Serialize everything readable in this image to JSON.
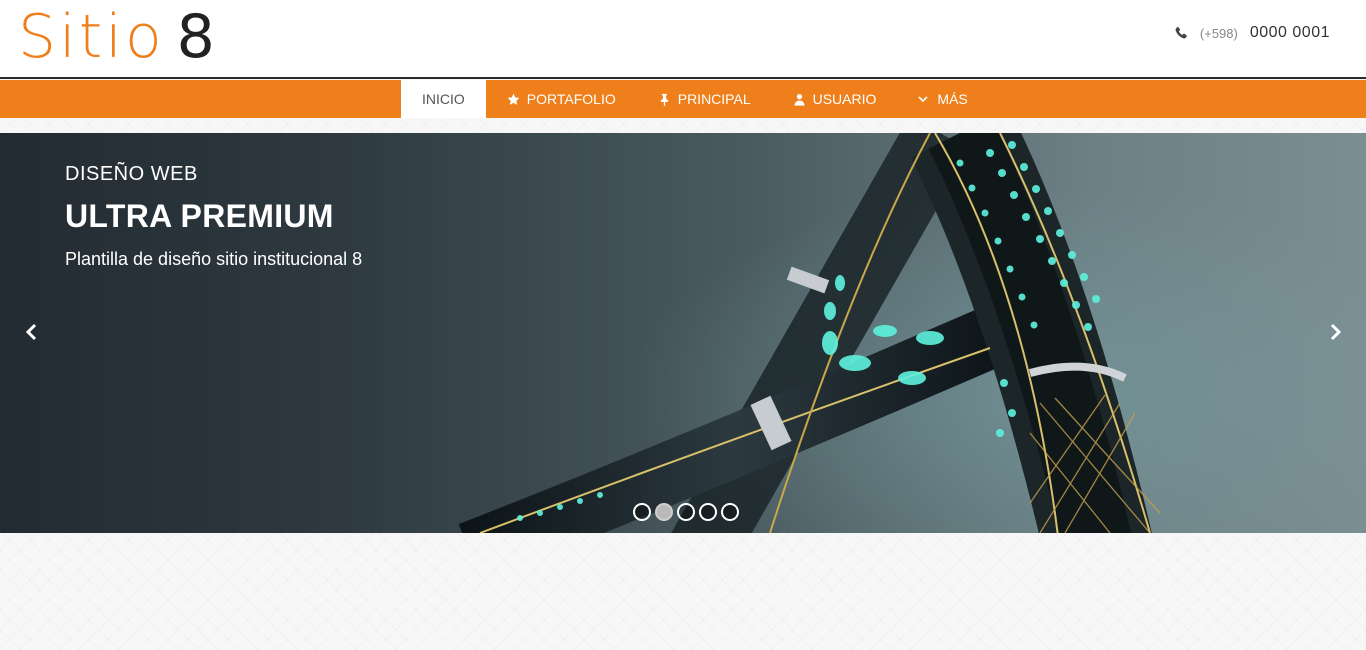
{
  "header": {
    "logo_word": "Sitio",
    "logo_number": "8",
    "phone_prefix": "(+598)",
    "phone_number": "0000 0001",
    "phone_icon": "phone-icon"
  },
  "nav": {
    "items": [
      {
        "label": "INICIO",
        "icon": null,
        "active": true
      },
      {
        "label": "PORTAFOLIO",
        "icon": "star-icon",
        "active": false
      },
      {
        "label": "PRINCIPAL",
        "icon": "pin-icon",
        "active": false
      },
      {
        "label": "USUARIO",
        "icon": "user-icon",
        "active": false
      },
      {
        "label": "MÁS",
        "icon": "chevron-down-icon",
        "active": false
      }
    ]
  },
  "slider": {
    "kicker": "DISEÑO WEB",
    "title": "ULTRA PREMIUM",
    "subtitle": "Plantilla de diseño sitio institucional 8",
    "slide_count": 5,
    "active_slide": 2
  },
  "colors": {
    "brand": "#ef7f1a",
    "dark": "#222222",
    "white": "#ffffff"
  }
}
